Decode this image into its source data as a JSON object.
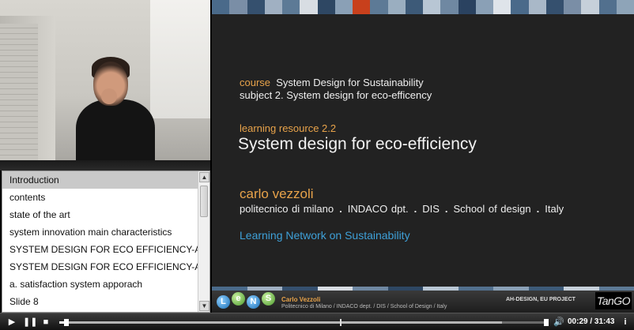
{
  "chapters": {
    "items": [
      {
        "label": "Introduction",
        "active": true
      },
      {
        "label": "contents"
      },
      {
        "label": "state of the art"
      },
      {
        "label": "system innovation main characteristics"
      },
      {
        "label": "SYSTEM DESIGN FOR ECO EFFICIENCY-A"
      },
      {
        "label": "SYSTEM DESIGN FOR ECO EFFICIENCY-A"
      },
      {
        "label": "a. satisfaction system apporach"
      },
      {
        "label": "Slide 8"
      }
    ]
  },
  "slide": {
    "course_label": "course",
    "course_name": "System Design for Sustainability",
    "subject": "subject 2. System design for eco-efficency",
    "learning_resource": "learning resource 2.2",
    "title": "System design for eco-efficiency",
    "author_name": "carlo vezzoli",
    "affiliation": [
      "politecnico di milano",
      "INDACO dpt.",
      "DIS",
      "School of design",
      "Italy"
    ],
    "network": "Learning Network on Sustainability",
    "bar_colors": [
      "#4a6a8a",
      "#7a8ea6",
      "#35506e",
      "#a0b0c2",
      "#5d7a96",
      "#d8dde3",
      "#2e4763",
      "#8aa0b6",
      "#c8401c",
      "#5d7a96",
      "#9aaec0",
      "#3d5a78",
      "#b8c6d4",
      "#6f88a2",
      "#2a4260",
      "#8aa0b6",
      "#dfe4ea",
      "#4a6a8a",
      "#a9b8c8",
      "#35506e",
      "#7a8ea6",
      "#c6d0da",
      "#52708e",
      "#8ea4b8"
    ],
    "footer_stripe_colors": [
      "#4a6a8a",
      "#a0b0c2",
      "#35506e",
      "#d8dde3",
      "#6f88a2",
      "#2e4763",
      "#b8c6d4",
      "#52708e",
      "#8aa0b6",
      "#3d5a78",
      "#c6d0da",
      "#5d7a96"
    ]
  },
  "footer": {
    "logo_letters": [
      "L",
      "e",
      "N",
      "S"
    ],
    "author": "Carlo Vezzoli",
    "affiliation": "Politecnico di Milano / INDACO dept. / DIS / School of Design / Italy",
    "project": "AH-DESIGN, EU PROJECT",
    "partner_logo": "TanGO"
  },
  "player": {
    "rewind_icon": "▶",
    "pause_icon": "❚❚",
    "stop_icon": "■",
    "volume_icon": "🔊",
    "info_icon": "i",
    "time": "00:29 / 31:43",
    "progress": 0.015
  }
}
